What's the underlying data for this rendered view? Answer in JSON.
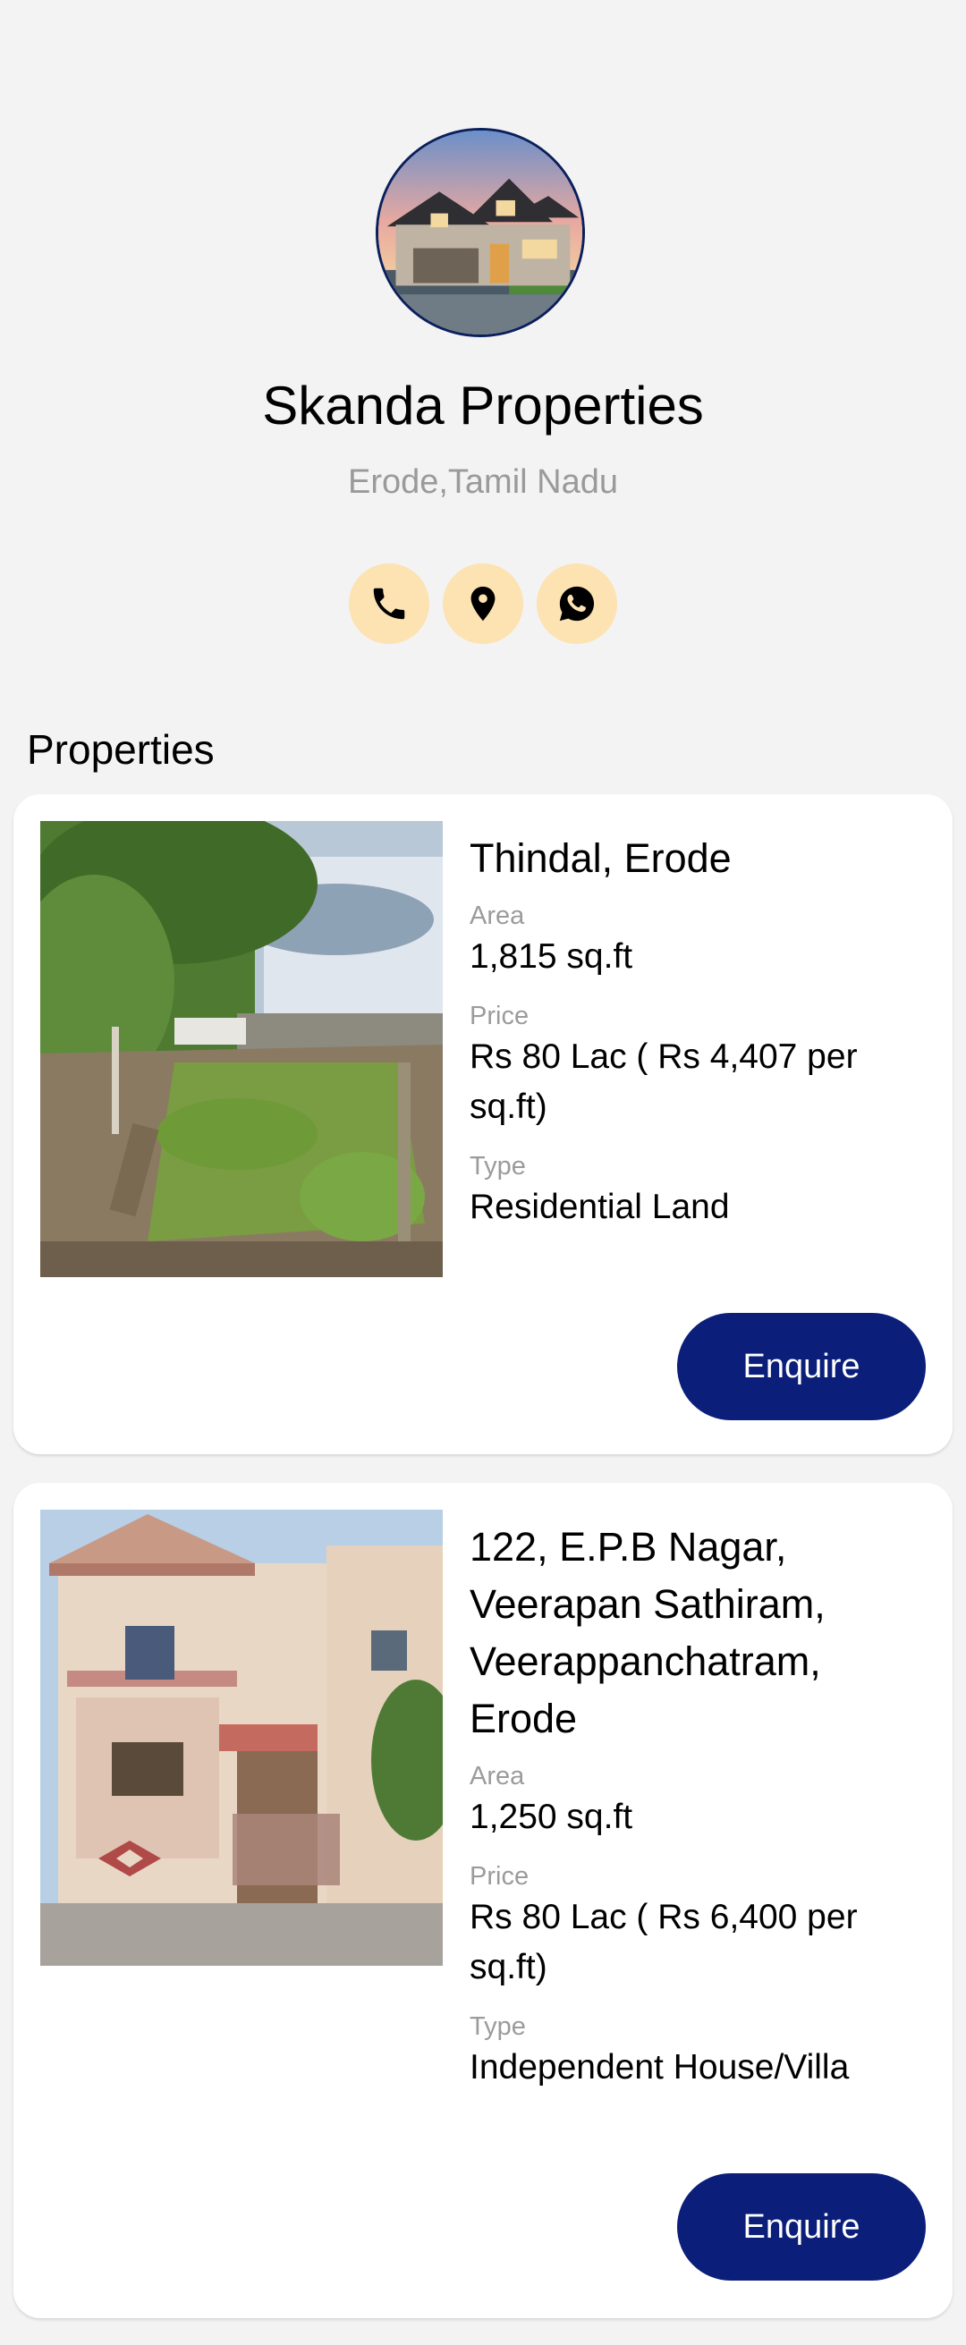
{
  "profile": {
    "name": "Skanda Properties",
    "location": "Erode,Tamil Nadu",
    "avatar_icon": "house-photo",
    "contacts": [
      {
        "icon": "phone-icon"
      },
      {
        "icon": "location-pin-icon"
      },
      {
        "icon": "whatsapp-icon"
      }
    ],
    "contact_bg": "#fde2b2"
  },
  "properties_section": {
    "title": "Properties"
  },
  "properties": [
    {
      "title": "Thindal, Erode",
      "area_label": "Area",
      "area": "1,815 sq.ft",
      "price_label": "Price",
      "price": "Rs 80 Lac ( Rs 4,407 per sq.ft)",
      "type_label": "Type",
      "type": "Residential Land",
      "enquire_label": "Enquire"
    },
    {
      "title": "122, E.P.B Nagar, Veerapan Sathiram, Veerappanchatram, Erode",
      "area_label": "Area",
      "area": "1,250 sq.ft",
      "price_label": "Price",
      "price": "Rs 80 Lac ( Rs 6,400 per sq.ft)",
      "type_label": "Type",
      "type": "Independent House/Villa",
      "enquire_label": "Enquire"
    }
  ],
  "colors": {
    "accent": "#0b1f7a",
    "background": "#f3f3f3"
  }
}
